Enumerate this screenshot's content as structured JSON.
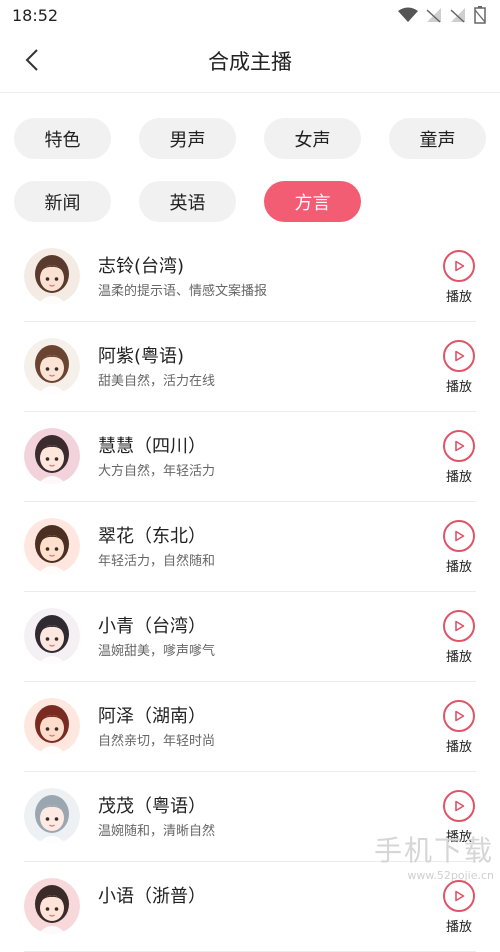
{
  "status_bar": {
    "time": "18:52"
  },
  "header": {
    "title": "合成主播"
  },
  "categories": [
    [
      {
        "label": "特色"
      },
      {
        "label": "男声"
      },
      {
        "label": "女声"
      },
      {
        "label": "童声"
      }
    ],
    [
      {
        "label": "新闻"
      },
      {
        "label": "英语"
      },
      {
        "label": "方言",
        "active": true
      }
    ]
  ],
  "hosts": [
    {
      "name": "志铃(台湾)",
      "desc": "温柔的提示语、情感文案播报",
      "play": "播放",
      "hair": "#5a3a2c",
      "bg": "#f4ece4",
      "skin": "#fbe1d2"
    },
    {
      "name": "阿紫(粤语)",
      "desc": "甜美自然，活力在线",
      "play": "播放",
      "hair": "#6b4431",
      "bg": "#f6f0ea",
      "skin": "#fbe3d6"
    },
    {
      "name": "慧慧（四川）",
      "desc": "大方自然，年轻活力",
      "play": "播放",
      "hair": "#3b2a2e",
      "bg": "#f2d3dc",
      "skin": "#fde6dc"
    },
    {
      "name": "翠花（东北）",
      "desc": "年轻活力，自然随和",
      "play": "播放",
      "hair": "#4a2f22",
      "bg": "#ffe7e0",
      "skin": "#ffe0cc"
    },
    {
      "name": "小青（台湾）",
      "desc": "温婉甜美，嗲声嗲气",
      "play": "播放",
      "hair": "#2f2a32",
      "bg": "#f5f0f3",
      "skin": "#fde8df"
    },
    {
      "name": "阿泽（湖南）",
      "desc": "自然亲切，年轻时尚",
      "play": "播放",
      "hair": "#7a2b21",
      "bg": "#fde7df",
      "skin": "#fddccb"
    },
    {
      "name": "茂茂（粤语）",
      "desc": "温婉随和，清晰自然",
      "play": "播放",
      "hair": "#9aa6b0",
      "bg": "#eef1f4",
      "skin": "#fdeae2"
    },
    {
      "name": "小语（浙普）",
      "desc": "",
      "play": "播放",
      "hair": "#3a2a28",
      "bg": "#f7d9dc",
      "skin": "#fde3d8"
    }
  ],
  "watermark": {
    "main": "手机下载",
    "sub": "www.52pojie.cn"
  },
  "colors": {
    "accent": "#f25d74",
    "play": "#e05467"
  }
}
